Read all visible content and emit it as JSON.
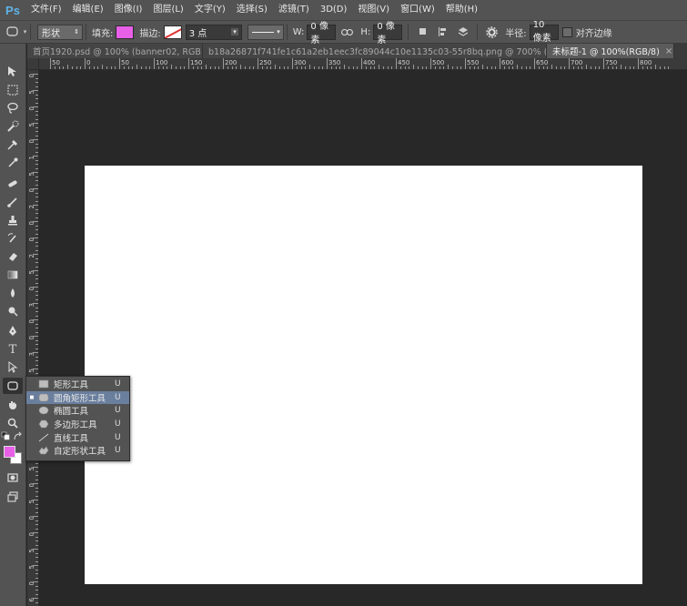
{
  "app": {
    "logo": "Ps"
  },
  "menu": [
    "文件(F)",
    "编辑(E)",
    "图像(I)",
    "图层(L)",
    "文字(Y)",
    "选择(S)",
    "滤镜(T)",
    "3D(D)",
    "视图(V)",
    "窗口(W)",
    "帮助(H)"
  ],
  "options": {
    "mode": "形状",
    "fill_label": "填充:",
    "stroke_label": "描边:",
    "stroke_width": "3 点",
    "w_label": "W:",
    "w_value": "0 像素",
    "h_label": "H:",
    "h_value": "0 像素",
    "radius_label": "半径:",
    "radius_value": "10 像素",
    "align_edges_label": "对齐边缘",
    "fill_color": "#e85fe8",
    "stroke_color": "#ffffff"
  },
  "tabs": [
    {
      "label": "首页1920.psd @ 100% (banner02, RGB...",
      "active": false
    },
    {
      "label": "b18a26871f741fe1c61a2eb1eec3fc89044c10e1135c03-55r8bq.png @ 700% (背景...",
      "active": false
    },
    {
      "label": "未标题-1 @ 100%(RGB/8)",
      "active": true
    }
  ],
  "tab_close": "×",
  "ruler_h": [
    "50",
    "0",
    "50",
    "100",
    "150",
    "200",
    "250",
    "300",
    "350",
    "400",
    "450",
    "500",
    "550",
    "600",
    "650",
    "700",
    "750",
    "800"
  ],
  "ruler_v": [
    "0",
    "5",
    "0",
    "5",
    "0",
    "1",
    "5",
    "0",
    "2",
    "0",
    "0",
    "2",
    "5",
    "0",
    "3",
    "0",
    "0",
    "3",
    "5",
    "0",
    "4",
    "0",
    "0",
    "4",
    "5",
    "0",
    "5",
    "0",
    "0",
    "5",
    "5",
    "0",
    "6"
  ],
  "flyout": [
    {
      "icon": "rectangle-icon",
      "label": "矩形工具",
      "key": "U",
      "active": false
    },
    {
      "icon": "rounded-rectangle-icon",
      "label": "圆角矩形工具",
      "key": "U",
      "active": true
    },
    {
      "icon": "ellipse-icon",
      "label": "椭圆工具",
      "key": "U",
      "active": false
    },
    {
      "icon": "polygon-icon",
      "label": "多边形工具",
      "key": "U",
      "active": false
    },
    {
      "icon": "line-icon",
      "label": "直线工具",
      "key": "U",
      "active": false
    },
    {
      "icon": "custom-shape-icon",
      "label": "自定形状工具",
      "key": "U",
      "active": false
    }
  ],
  "flyout_bullet": "■",
  "colors": {
    "foreground": "#e85fe8",
    "background": "#ffffff",
    "canvas": "#ffffff",
    "workspace": "#282828",
    "highlight": "#6a7f9e"
  }
}
